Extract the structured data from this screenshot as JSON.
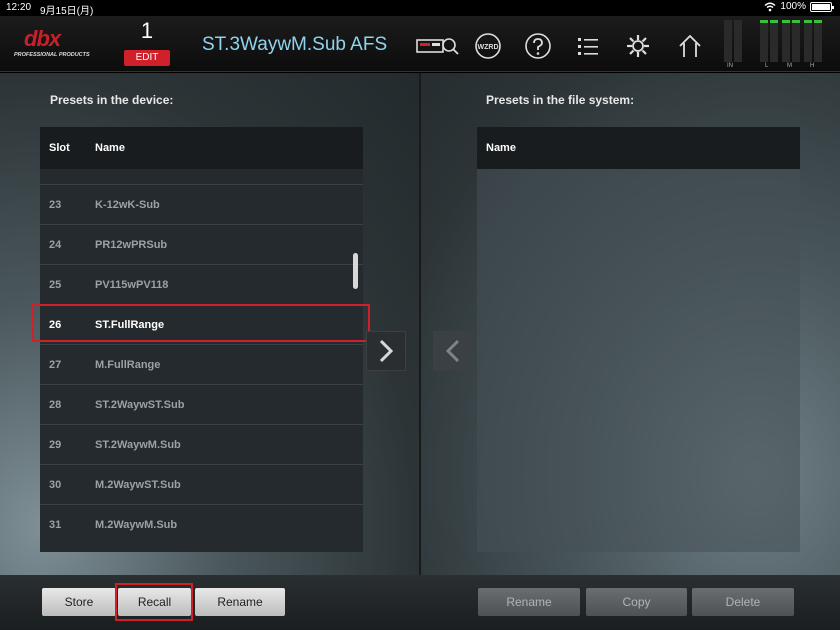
{
  "status": {
    "time": "12:20",
    "date": "9月15日(月)",
    "battery": "100%"
  },
  "header": {
    "logo": "dbx",
    "logo_sub": "PROFESSIONAL PRODUCTS",
    "preset_number": "1",
    "edit_label": "EDIT",
    "preset_title": "ST.3WaywM.Sub AFS",
    "wizard_label": "WZRD",
    "meter_labels": [
      "IN",
      "L",
      "M",
      "H"
    ]
  },
  "device_panel": {
    "title": "Presets in the device:",
    "columns": [
      "Slot",
      "Name"
    ],
    "rows": [
      {
        "slot": "23",
        "name": "K-12wK-Sub"
      },
      {
        "slot": "24",
        "name": "PR12wPRSub"
      },
      {
        "slot": "25",
        "name": "PV115wPV118"
      },
      {
        "slot": "26",
        "name": "ST.FullRange"
      },
      {
        "slot": "27",
        "name": "M.FullRange"
      },
      {
        "slot": "28",
        "name": "ST.2WaywST.Sub"
      },
      {
        "slot": "29",
        "name": "ST.2WaywM.Sub"
      },
      {
        "slot": "30",
        "name": "M.2WaywST.Sub"
      },
      {
        "slot": "31",
        "name": "M.2WaywM.Sub"
      }
    ],
    "selected_slot": "26"
  },
  "file_panel": {
    "title": "Presets in the file system:",
    "columns": [
      "Name"
    ]
  },
  "footer": {
    "store": "Store",
    "recall": "Recall",
    "rename_left": "Rename",
    "rename_right": "Rename",
    "copy": "Copy",
    "delete": "Delete"
  },
  "colors": {
    "accent": "#d0202a",
    "title": "#8fd4ef"
  }
}
